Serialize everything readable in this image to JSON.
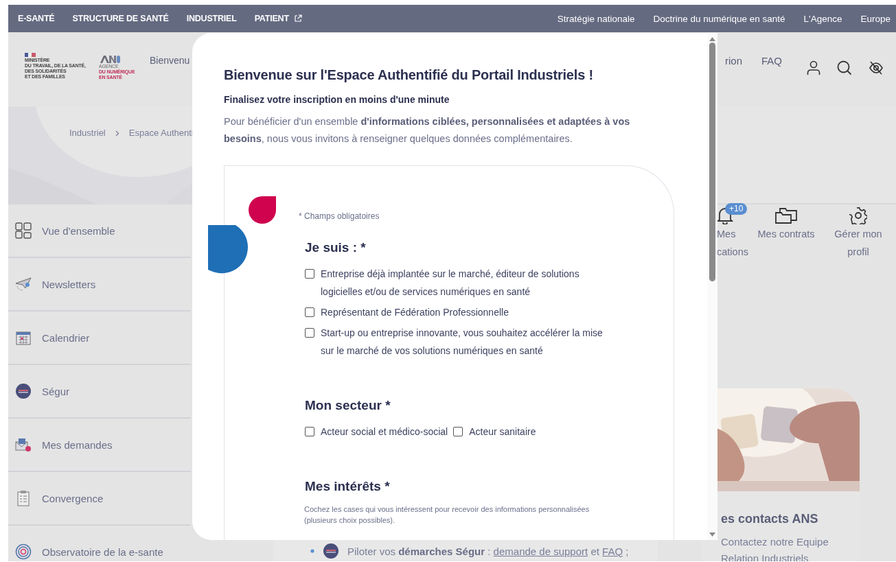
{
  "top_nav": {
    "left": [
      {
        "label": "E-SANTÉ",
        "external": false
      },
      {
        "label": "STRUCTURE DE SANTÉ",
        "external": false
      },
      {
        "label": "INDUSTRIEL",
        "external": false
      },
      {
        "label": "PATIENT",
        "external": true
      }
    ],
    "right": [
      "Stratégie nationale",
      "Doctrine du numérique en santé",
      "L'Agence",
      "Europe"
    ]
  },
  "header": {
    "ministry_logo": {
      "lines": [
        "MINISTÈRE",
        "DU TRAVAIL, DE LA SANTÉ,",
        "DES SOLIDARITÉS",
        "ET DES FAMILLES"
      ]
    },
    "agency_logo": {
      "lines": [
        "AGENCE",
        "DU NUMÉRIQUE",
        "EN SANTÉ"
      ]
    },
    "nav_left": "Bienvenu",
    "nav_right": [
      "rion",
      "FAQ"
    ]
  },
  "breadcrumb": [
    "Industriel",
    "Espace Authenti"
  ],
  "sidebar": {
    "items": [
      "Vue d'ensemble",
      "Newsletters",
      "Calendrier",
      "Ségur",
      "Mes demandes",
      "Convergence",
      "Observatoire de la e-sante"
    ]
  },
  "shortcuts": [
    {
      "lines": [
        "Mes",
        "cations"
      ],
      "badge": "+10"
    },
    {
      "lines": [
        "Mes contrats"
      ]
    },
    {
      "lines": [
        "Gérer mon",
        "profil"
      ]
    }
  ],
  "contact_card": {
    "image": {
      "kind": "picture"
    },
    "title": "es contacts ANS",
    "lines": [
      "Contactez notre Equipe",
      "Relation Industriels"
    ]
  },
  "interest_item": {
    "text": "Piloter vos **démarches Ségur** :",
    "links": [
      "demande de support",
      "FAQ"
    ],
    "joiner": "et",
    "end": ";"
  },
  "modal": {
    "title": "Bienvenue sur l'Espace Authentifié du Portail Industriels !",
    "subtitle": "Finalisez votre inscription en moins d'une minute",
    "intro": "Pour bénéficier d'un ensemble **d'informations ciblées, personnalisées et adaptées à vos besoins**, nous vous invitons à renseigner quelques données complémentaires.",
    "required_note": "* Champs obligatoires",
    "sections": [
      {
        "title": "Je suis : *",
        "kind": "stack",
        "options": [
          {
            "label": "Entreprise déjà implantée sur le marché, éditeur de solutions logicielles et/ou de services numériques en santé",
            "checked": false
          },
          {
            "label": "Représentant de Fédération Professionnelle",
            "checked": false
          },
          {
            "label": "Start-up ou entreprise innovante, vous souhaitez accélérer la mise sur le marché de vos solutions numériques en santé",
            "checked": false
          }
        ]
      },
      {
        "title": "Mon secteur *",
        "kind": "inline",
        "options": [
          {
            "label": "Acteur social et médico-social",
            "checked": false
          },
          {
            "label": "Acteur sanitaire",
            "checked": false
          }
        ]
      },
      {
        "title": "Mes intérêts *",
        "hint": "Cochez les cases qui vous intéressent pour recevoir des informations personnalisées (plusieurs choix possibles)."
      }
    ]
  }
}
